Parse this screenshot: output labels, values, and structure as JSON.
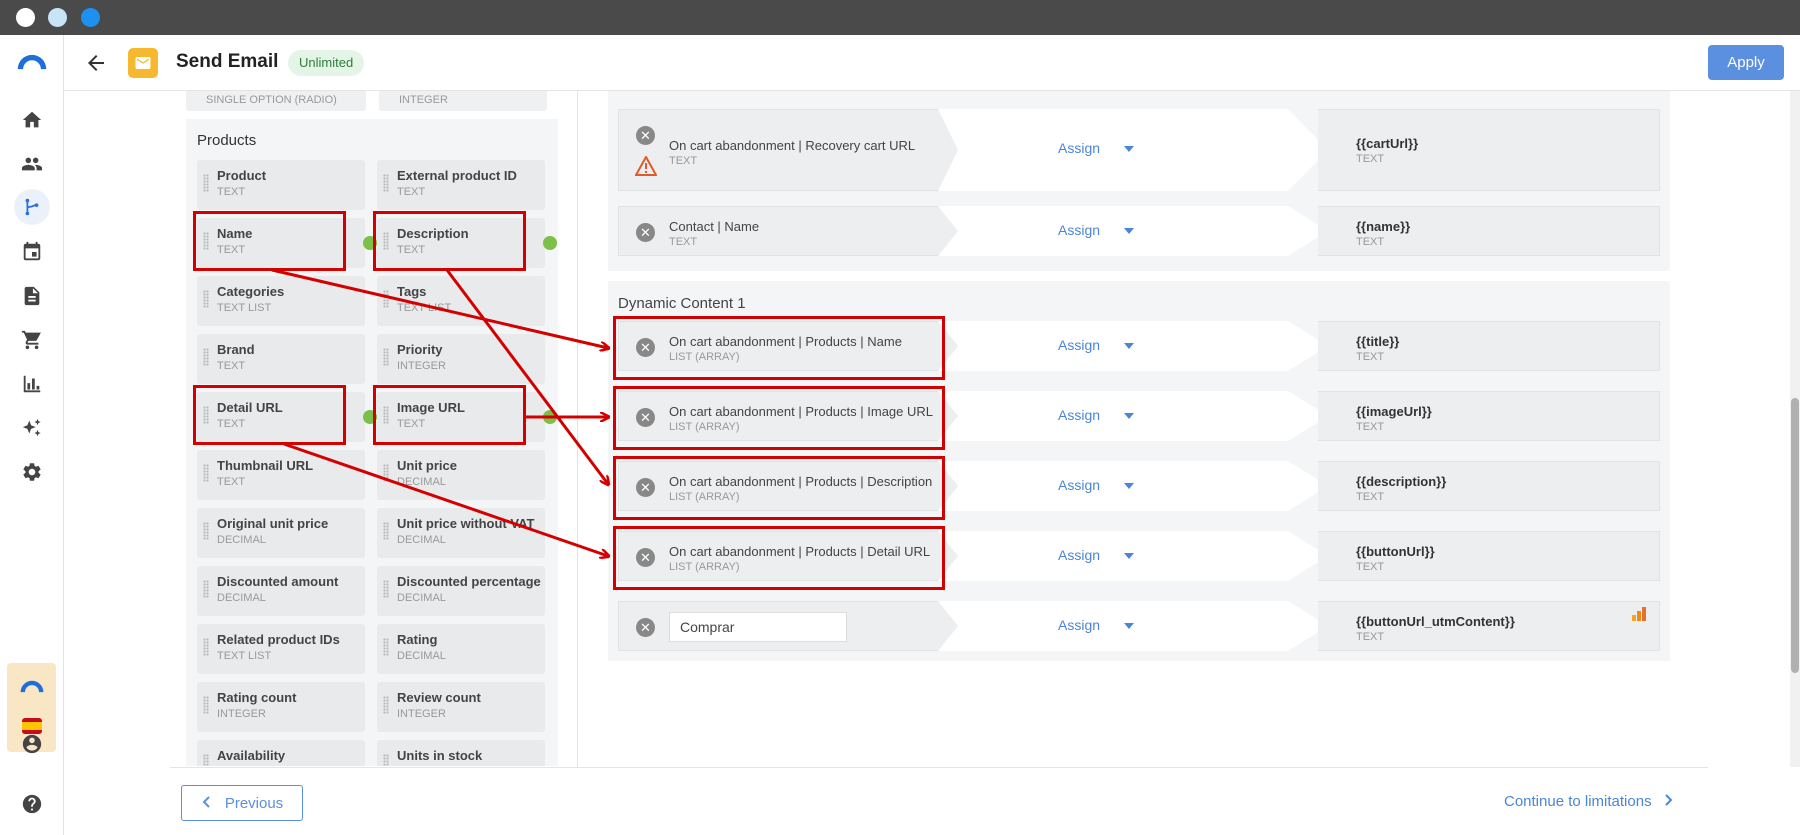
{
  "header": {
    "title": "Send Email",
    "badge": "Unlimited",
    "apply_label": "Apply"
  },
  "nav": {
    "icons": [
      "home-icon",
      "contacts-icon",
      "workflow-icon",
      "calendar-icon",
      "document-icon",
      "cart-icon",
      "chart-icon",
      "sparkle-icon",
      "gear-icon",
      "user-icon",
      "help-icon"
    ]
  },
  "left_panel": {
    "top_types": [
      "SINGLE OPTION (RADIO)",
      "INTEGER"
    ],
    "section_title": "Products",
    "fields": [
      {
        "name": "Product",
        "type": "TEXT"
      },
      {
        "name": "External product ID",
        "type": "TEXT"
      },
      {
        "name": "Name",
        "type": "TEXT"
      },
      {
        "name": "Description",
        "type": "TEXT"
      },
      {
        "name": "Categories",
        "type": "TEXT LIST"
      },
      {
        "name": "Tags",
        "type": "TEXT LIST"
      },
      {
        "name": "Brand",
        "type": "TEXT"
      },
      {
        "name": "Priority",
        "type": "INTEGER"
      },
      {
        "name": "Detail URL",
        "type": "TEXT"
      },
      {
        "name": "Image URL",
        "type": "TEXT"
      },
      {
        "name": "Thumbnail URL",
        "type": "TEXT"
      },
      {
        "name": "Unit price",
        "type": "DECIMAL"
      },
      {
        "name": "Original unit price",
        "type": "DECIMAL"
      },
      {
        "name": "Unit price without VAT",
        "type": "DECIMAL"
      },
      {
        "name": "Discounted amount",
        "type": "DECIMAL"
      },
      {
        "name": "Discounted percentage",
        "type": "DECIMAL"
      },
      {
        "name": "Related product IDs",
        "type": "TEXT LIST"
      },
      {
        "name": "Rating",
        "type": "DECIMAL"
      },
      {
        "name": "Rating count",
        "type": "INTEGER"
      },
      {
        "name": "Review count",
        "type": "INTEGER"
      },
      {
        "name": "Availability",
        "type": ""
      },
      {
        "name": "Units in stock",
        "type": ""
      }
    ]
  },
  "mappings_top": [
    {
      "source": "On cart abandonment | Recovery cart URL",
      "source_type": "TEXT",
      "assign": "Assign",
      "target": "{{cartUrl}}",
      "target_type": "TEXT"
    },
    {
      "source": "Contact | Name",
      "source_type": "TEXT",
      "assign": "Assign",
      "target": "{{name}}",
      "target_type": "TEXT"
    }
  ],
  "dynamic_group": {
    "title": "Dynamic Content 1",
    "rows": [
      {
        "source": "On cart abandonment | Products | Name",
        "source_type": "LIST (ARRAY)",
        "assign": "Assign",
        "target": "{{title}}",
        "target_type": "TEXT"
      },
      {
        "source": "On cart abandonment | Products | Image URL",
        "source_type": "LIST (ARRAY)",
        "assign": "Assign",
        "target": "{{imageUrl}}",
        "target_type": "TEXT"
      },
      {
        "source": "On cart abandonment | Products | Description",
        "source_type": "LIST (ARRAY)",
        "assign": "Assign",
        "target": "{{description}}",
        "target_type": "TEXT"
      },
      {
        "source": "On cart abandonment | Products | Detail URL",
        "source_type": "LIST (ARRAY)",
        "assign": "Assign",
        "target": "{{buttonUrl}}",
        "target_type": "TEXT"
      }
    ],
    "text_row": {
      "value": "Comprar",
      "assign": "Assign",
      "target": "{{buttonUrl_utmContent}}",
      "target_type": "TEXT"
    }
  },
  "footer": {
    "previous_label": "Previous",
    "continue_label": "Continue to limitations"
  },
  "colors": {
    "accent": "#5b8fe0",
    "highlight": "#d40000",
    "badge_bg": "#e4f4e6",
    "mail_icon": "#f5b82e"
  }
}
